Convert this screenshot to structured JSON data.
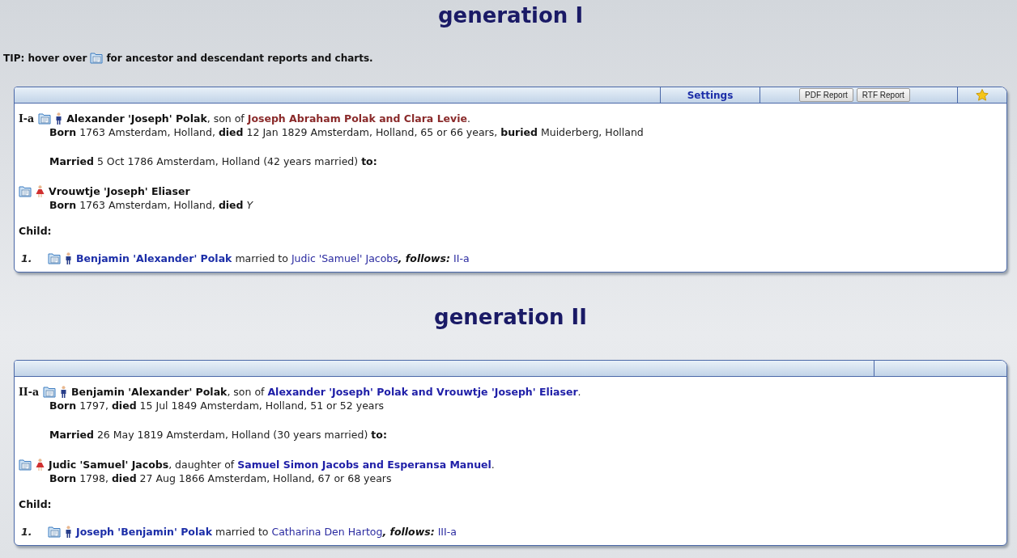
{
  "generations": [
    {
      "title": "generation I",
      "tip": {
        "before": "TIP: hover over",
        "after": "for ancestor and descendant reports and charts."
      },
      "toolbar": {
        "settings": "Settings",
        "buttons": [
          "PDF Report",
          "RTF Report"
        ],
        "favorite": true
      },
      "person": {
        "ref": "I-a",
        "kind": "male",
        "name": "Alexander 'Joseph' Polak",
        "relation": ", son of ",
        "parents": "Joseph Abraham Polak and Clara Levie",
        "parents_visited": true,
        "end": ".",
        "vitals": "**Born** 1763 Amsterdam, Holland, **died** 12 Jan 1829 Amsterdam, Holland, 65 or 66 years, **buried**  Muiderberg, Holland",
        "marriage": "**Married** 5 Oct 1786 Amsterdam, Holland (42 years married) **to:**"
      },
      "spouse": {
        "kind": "female",
        "name": "Vrouwtje 'Joseph' Eliaser",
        "vitals": "**Born** 1763 Amsterdam, Holland, **died** *Y*"
      },
      "children_label": "Child:",
      "children": [
        {
          "number": "1.",
          "kind": "male",
          "name": "Benjamin 'Alexander' Polak",
          "married": " married to ",
          "spouse": "Judic 'Samuel' Jacobs",
          "follows": ", follows:",
          "follows_ref": "II-a"
        }
      ]
    },
    {
      "title": "generation II",
      "person": {
        "ref": "II-a",
        "kind": "male",
        "name": "Benjamin 'Alexander' Polak",
        "relation": ", son of ",
        "parents": "Alexander 'Joseph' Polak and Vrouwtje 'Joseph' Eliaser",
        "parents_visited": false,
        "end": ".",
        "vitals": "**Born** 1797, **died** 15 Jul 1849 Amsterdam, Holland, 51 or 52 years",
        "marriage": "**Married** 26 May 1819 Amsterdam, Holland (30 years married) **to:**"
      },
      "spouse": {
        "kind": "female",
        "name": "Judic 'Samuel' Jacobs",
        "relation": ", daughter of ",
        "parents": "Samuel Simon Jacobs and Esperansa Manuel",
        "parents_visited": false,
        "end": ".",
        "vitals": "**Born** 1798, **died** 27 Aug 1866 Amsterdam, Holland, 67 or 68 years"
      },
      "children_label": "Child:",
      "children": [
        {
          "number": "1.",
          "kind": "male",
          "name": "Joseph 'Benjamin' Polak",
          "married": " married to ",
          "spouse": "Catharina Den Hartog",
          "follows": ", follows:",
          "follows_ref": "III-a"
        }
      ]
    }
  ]
}
